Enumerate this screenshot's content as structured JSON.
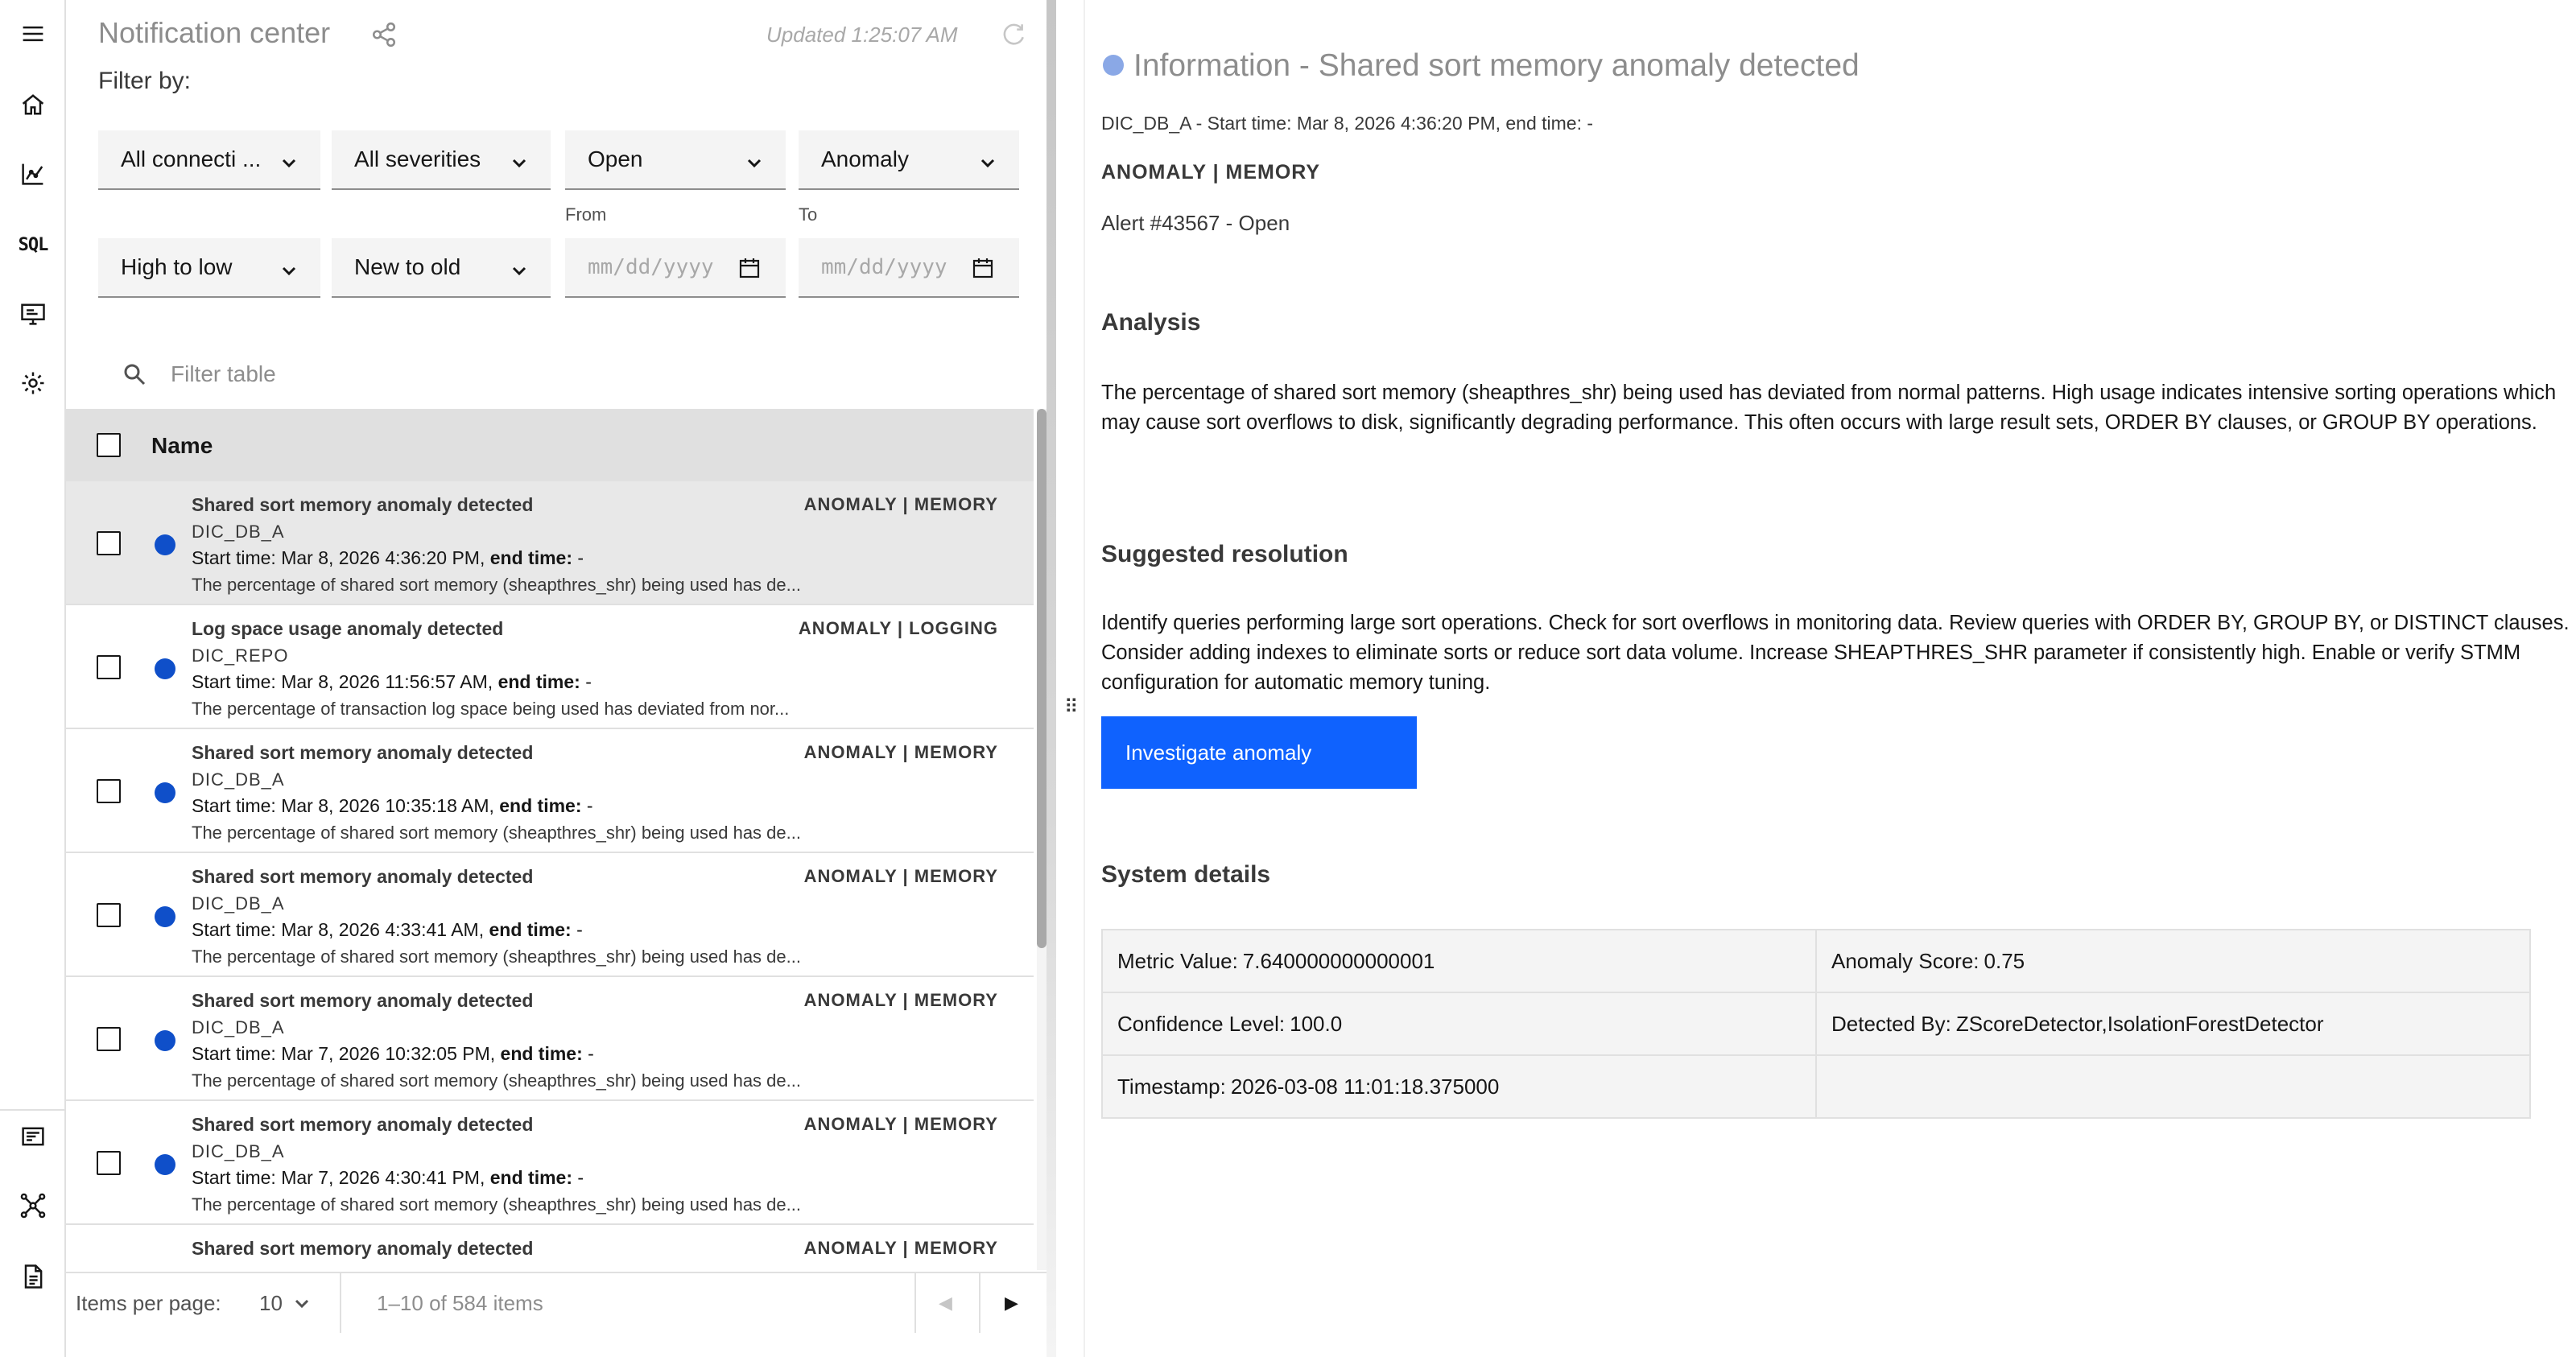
{
  "rail": {
    "items": [
      "menu-icon",
      "home-icon",
      "chart-icon",
      "sql-icon",
      "monitor-icon",
      "gear-icon"
    ],
    "sql_label": "SQL",
    "bottom_items": [
      "notes-icon",
      "network-icon",
      "document-icon"
    ]
  },
  "header": {
    "title": "Notification center",
    "updated": "Updated 1:25:07 AM",
    "filter_by": "Filter by:"
  },
  "filters": {
    "connections": "All connecti ...",
    "severities": "All severities",
    "status": "Open",
    "type": "Anomaly",
    "priority_sort": "High to low",
    "time_sort": "New to old",
    "from_label": "From",
    "to_label": "To",
    "date_placeholder": "mm/dd/yyyy"
  },
  "search": {
    "placeholder": "Filter table"
  },
  "table": {
    "header_name": "Name",
    "rows": [
      {
        "title": "Shared sort memory anomaly detected",
        "tag": "ANOMALY  |  MEMORY",
        "db": "DIC_DB_A",
        "start_label": "Start time:",
        "start": "Mar 8, 2026 4:36:20 PM,",
        "end_label": "end time:",
        "end": "-",
        "desc": "The percentage of shared sort memory (sheapthres_shr) being used has de..."
      },
      {
        "title": "Log space usage anomaly detected",
        "tag": "ANOMALY  |  LOGGING",
        "db": "DIC_REPO",
        "start_label": "Start time:",
        "start": "Mar 8, 2026 11:56:57 AM,",
        "end_label": "end time:",
        "end": "-",
        "desc": "The percentage of transaction log space being used has deviated from nor..."
      },
      {
        "title": "Shared sort memory anomaly detected",
        "tag": "ANOMALY  |  MEMORY",
        "db": "DIC_DB_A",
        "start_label": "Start time:",
        "start": "Mar 8, 2026 10:35:18 AM,",
        "end_label": "end time:",
        "end": "-",
        "desc": "The percentage of shared sort memory (sheapthres_shr) being used has de..."
      },
      {
        "title": "Shared sort memory anomaly detected",
        "tag": "ANOMALY  |  MEMORY",
        "db": "DIC_DB_A",
        "start_label": "Start time:",
        "start": "Mar 8, 2026 4:33:41 AM,",
        "end_label": "end time:",
        "end": "-",
        "desc": "The percentage of shared sort memory (sheapthres_shr) being used has de..."
      },
      {
        "title": "Shared sort memory anomaly detected",
        "tag": "ANOMALY  |  MEMORY",
        "db": "DIC_DB_A",
        "start_label": "Start time:",
        "start": "Mar 7, 2026 10:32:05 PM,",
        "end_label": "end time:",
        "end": "-",
        "desc": "The percentage of shared sort memory (sheapthres_shr) being used has de..."
      },
      {
        "title": "Shared sort memory anomaly detected",
        "tag": "ANOMALY  |  MEMORY",
        "db": "DIC_DB_A",
        "start_label": "Start time:",
        "start": "Mar 7, 2026 4:30:41 PM,",
        "end_label": "end time:",
        "end": "-",
        "desc": "The percentage of shared sort memory (sheapthres_shr) being used has de..."
      },
      {
        "title": "Shared sort memory anomaly detected",
        "tag": "ANOMALY  |  MEMORY",
        "db": "",
        "start_label": "",
        "start": "",
        "end_label": "",
        "end": "",
        "desc": ""
      }
    ]
  },
  "pager": {
    "items_per_page_label": "Items per page:",
    "items_per_page": "10",
    "range": "1–10 of 584 items",
    "prev": "◀",
    "next": "▶"
  },
  "splitter": {
    "grip": "⠿"
  },
  "detail": {
    "title": "Information - Shared sort memory anomaly detected",
    "subtitle": "DIC_DB_A - Start time: Mar 8, 2026 4:36:20 PM, end time: -",
    "tags": "ANOMALY | MEMORY",
    "alert": "Alert #43567 - Open",
    "analysis_heading": "Analysis",
    "analysis": "The percentage of shared sort memory (sheapthres_shr) being used has deviated from normal patterns. High usage indicates intensive sorting operations which may cause sort overflows to disk, significantly degrading performance. This often occurs with large result sets, ORDER BY clauses, or GROUP BY operations.",
    "resolution_heading": "Suggested resolution",
    "resolution": "Identify queries performing large sort operations. Check for sort overflows in monitoring data. Review queries with ORDER BY, GROUP BY, or DISTINCT clauses. Consider adding indexes to eliminate sorts or reduce sort data volume. Increase SHEAPTHRES_SHR parameter if consistently high. Enable or verify STMM configuration for automatic memory tuning.",
    "investigate_button": "Investigate anomaly",
    "system_heading": "System details",
    "system": {
      "metric_value_label": "Metric Value:",
      "metric_value": "7.640000000000001",
      "anomaly_score_label": "Anomaly Score:",
      "anomaly_score": "0.75",
      "confidence_label": "Confidence Level:",
      "confidence": "100.0",
      "detected_by_label": "Detected By:",
      "detected_by": "ZScoreDetector,IsolationForestDetector",
      "timestamp_label": "Timestamp:",
      "timestamp": "2026-03-08 11:01:18.375000"
    }
  },
  "colors": {
    "accent": "#0f62fe",
    "status_dot": "#0f4fc9",
    "title_dot": "#8aa8e6"
  }
}
